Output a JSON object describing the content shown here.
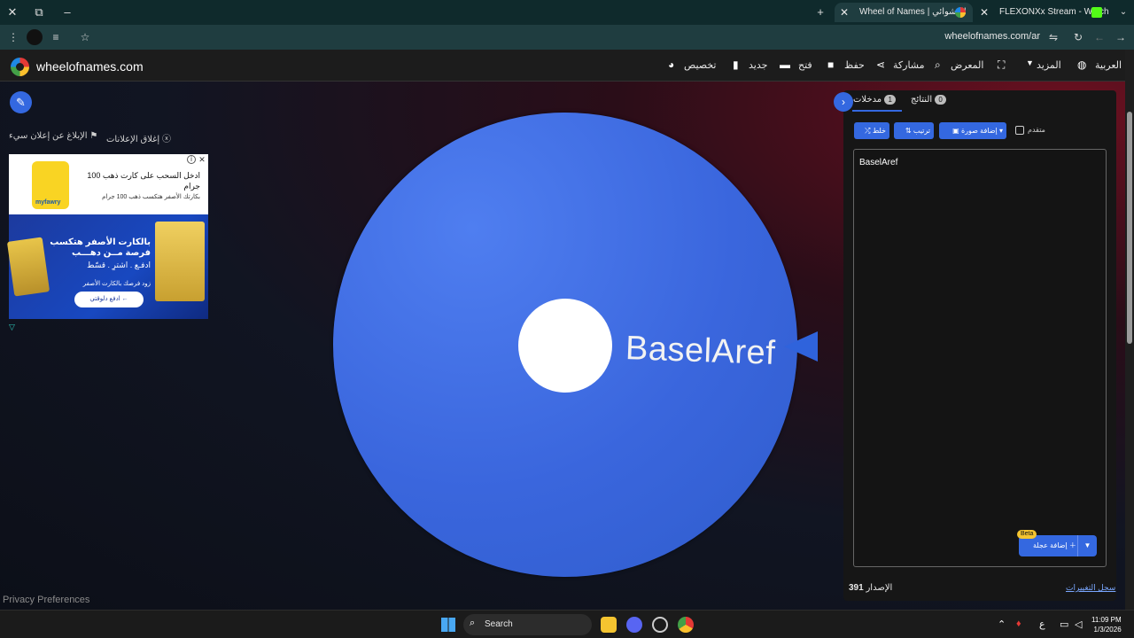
{
  "browser": {
    "tabs": [
      {
        "title": "Wheel of Names | العشوائي",
        "active": true
      },
      {
        "title": "FLEXONXx Stream - Watch",
        "active": false
      }
    ],
    "url": "wheelofnames.com/ar"
  },
  "site": {
    "name": "wheelofnames.com",
    "nav": {
      "customize": "تخصيص",
      "new": "جديد",
      "open": "فتح",
      "save": "حفظ",
      "share": "مشاركة",
      "gallery": "المعرض",
      "more": "المزيد",
      "language": "العربية"
    }
  },
  "left": {
    "report_ad": "الإبلاغ عن إعلان سيء",
    "close_ads": "إغلاق الإعلانات",
    "privacy": "Privacy Preferences"
  },
  "ad": {
    "title": "ادخل السحب على كارت ذهب 100 جرام",
    "subtitle": "بكارتك الأصفر هتكسب ذهب 100 جرام",
    "logo_text": "myfawry",
    "headline": "بالكارت الأصفر هتكسب فرصة مــن دهـــب",
    "line2": "ادفـع . اشترِ . قسّط",
    "line3": "زود فرصك بالكارت الأصفر",
    "cta": "← ادفع دلوقتي"
  },
  "wheel": {
    "entry_label": "BaselAref",
    "color": "#3a66dd"
  },
  "panel": {
    "tab_entries": "مدخلات",
    "tab_entries_count": "1",
    "tab_results": "النتائج",
    "tab_results_count": "0",
    "shuffle": "خلط",
    "sort": "ترتيب",
    "add_image": "إضافة صورة",
    "advanced": "متقدم",
    "entries_text": "BaselAref",
    "add_wheel": "إضافة عجلة",
    "beta": "Beta",
    "version_label": "الإصدار",
    "version": "391",
    "changelog": "سجل التغييرات"
  },
  "taskbar": {
    "search": "Search",
    "time": "11:09 PM",
    "date": "1/3/2026",
    "lang": "ع"
  }
}
